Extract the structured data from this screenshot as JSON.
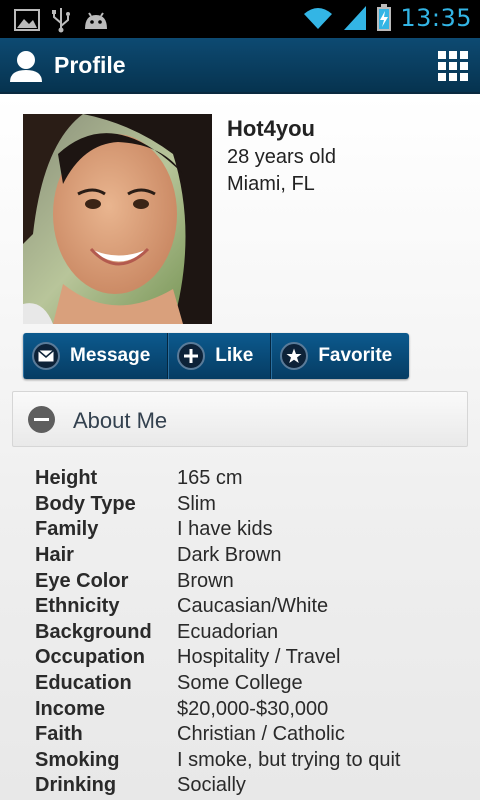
{
  "status_bar": {
    "time": "13:35",
    "icons": [
      "gallery-icon",
      "usb-icon",
      "android-icon",
      "wifi-icon",
      "signal-icon",
      "battery-charging-icon"
    ],
    "accent_color": "#33b5e5"
  },
  "app_bar": {
    "title": "Profile",
    "left_icon": "user-icon",
    "right_icon": "grid-menu-icon"
  },
  "profile": {
    "name": "Hot4you",
    "age": "28 years old",
    "location": "Miami, FL"
  },
  "actions": {
    "message_label": "Message",
    "like_label": "Like",
    "favorite_label": "Favorite"
  },
  "about": {
    "title": "About Me",
    "rows": [
      {
        "label": "Height",
        "value": "165 cm"
      },
      {
        "label": "Body Type",
        "value": "Slim"
      },
      {
        "label": "Family",
        "value": "I have kids"
      },
      {
        "label": "Hair",
        "value": "Dark Brown"
      },
      {
        "label": "Eye Color",
        "value": "Brown"
      },
      {
        "label": "Ethnicity",
        "value": "Caucasian/White"
      },
      {
        "label": "Background",
        "value": "Ecuadorian"
      },
      {
        "label": "Occupation",
        "value": "Hospitality / Travel"
      },
      {
        "label": "Education",
        "value": "Some College"
      },
      {
        "label": "Income",
        "value": "$20,000-$30,000"
      },
      {
        "label": "Faith",
        "value": "Christian / Catholic"
      },
      {
        "label": "Smoking",
        "value": "I smoke, but trying to quit"
      },
      {
        "label": "Drinking",
        "value": "Socially"
      }
    ]
  }
}
